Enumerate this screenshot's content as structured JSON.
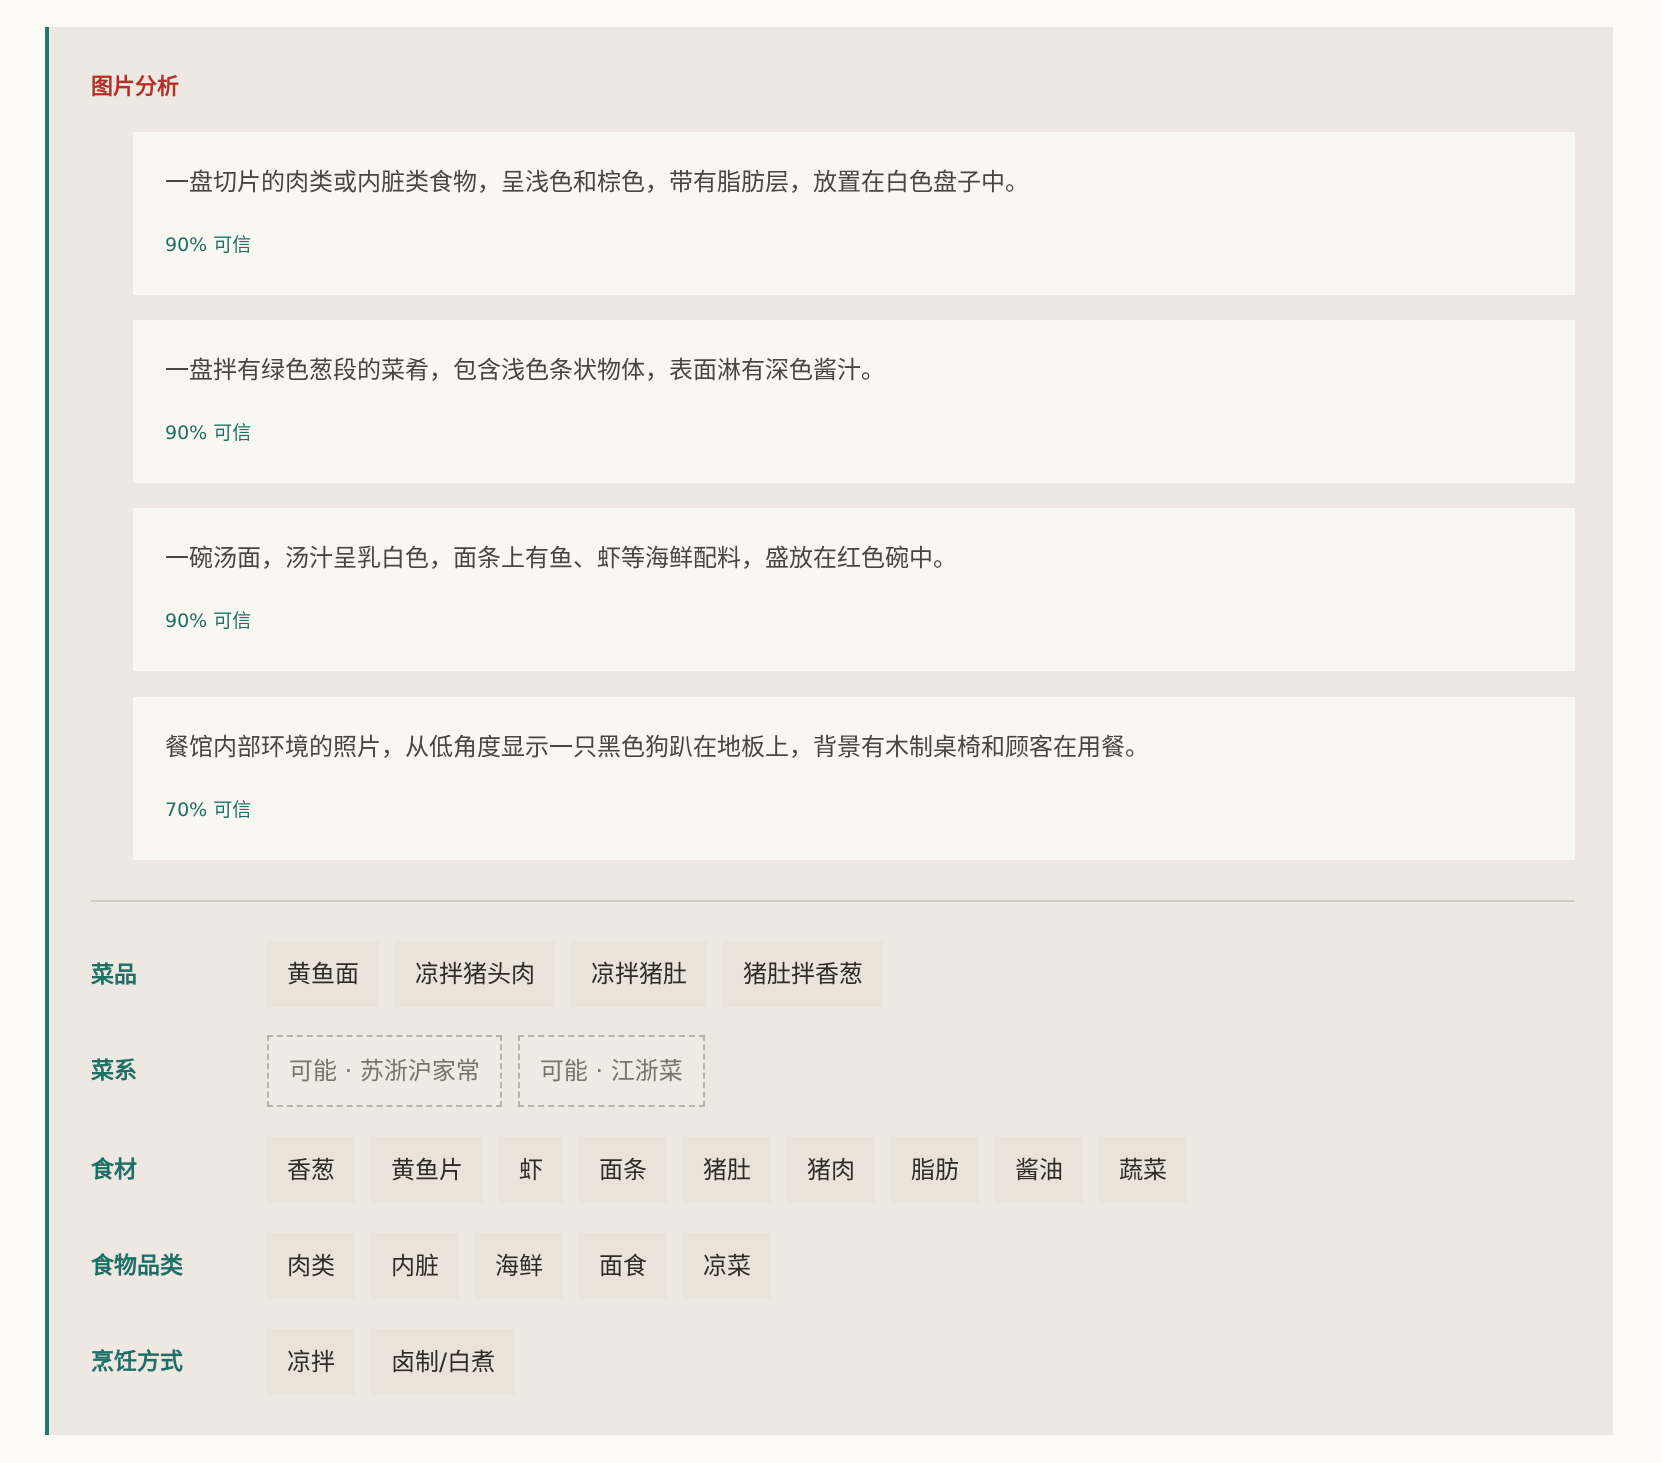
{
  "analysis": {
    "title": "图片分析",
    "items": [
      {
        "description": "一盘切片的肉类或内脏类食物，呈浅色和棕色，带有脂肪层，放置在白色盘子中。",
        "confidence": "90% 可信"
      },
      {
        "description": "一盘拌有绿色葱段的菜肴，包含浅色条状物体，表面淋有深色酱汁。",
        "confidence": "90% 可信"
      },
      {
        "description": "一碗汤面，汤汁呈乳白色，面条上有鱼、虾等海鲜配料，盛放在红色碗中。",
        "confidence": "90% 可信"
      },
      {
        "description": "餐馆内部环境的照片，从低角度显示一只黑色狗趴在地板上，背景有木制桌椅和顾客在用餐。",
        "confidence": "70% 可信"
      }
    ]
  },
  "rows": {
    "dishes": {
      "label": "菜品",
      "tags": [
        "黄鱼面",
        "凉拌猪头肉",
        "凉拌猪肚",
        "猪肚拌香葱"
      ]
    },
    "cuisine": {
      "label": "菜系",
      "tags": [
        "可能 · 苏浙沪家常",
        "可能 · 江浙菜"
      ]
    },
    "ingredients": {
      "label": "食材",
      "tags": [
        "香葱",
        "黄鱼片",
        "虾",
        "面条",
        "猪肚",
        "猪肉",
        "脂肪",
        "酱油",
        "蔬菜"
      ]
    },
    "categories": {
      "label": "食物品类",
      "tags": [
        "肉类",
        "内脏",
        "海鲜",
        "面食",
        "凉菜"
      ]
    },
    "methods": {
      "label": "烹饪方式",
      "tags": [
        "凉拌",
        "卤制/白煮"
      ]
    }
  },
  "colors": {
    "accent": "#1f7a6f",
    "title": "#b2322a",
    "panel": "#ede8e1",
    "card": "#f8f7f2"
  }
}
